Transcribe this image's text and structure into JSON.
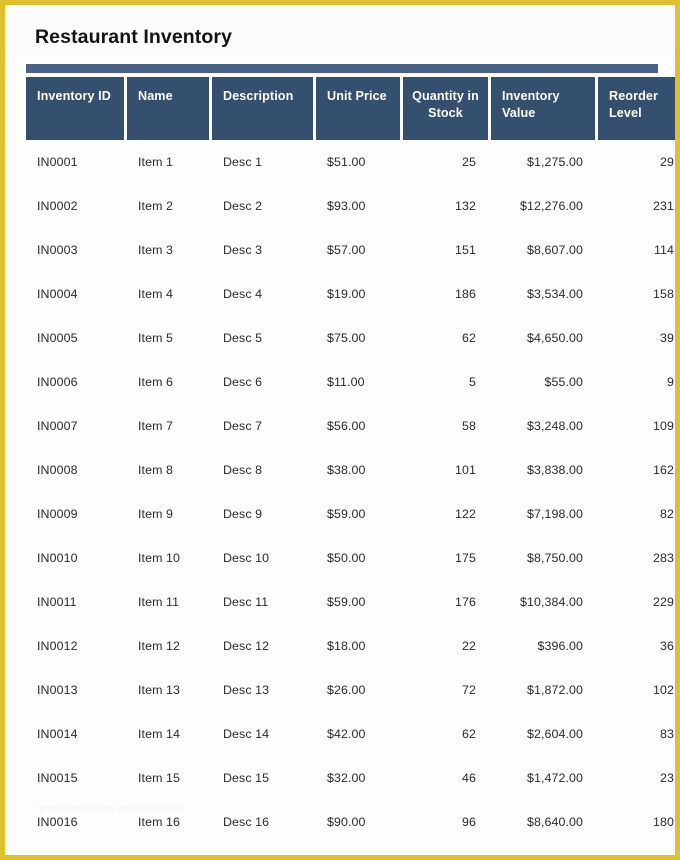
{
  "page": {
    "title": "Restaurant Inventory",
    "border_color": "#dfc12e",
    "accent_bar_color": "#4a6285",
    "header_color": "#35506f",
    "background_color": "#fdfdfb",
    "watermark": "www.templates-example.com"
  },
  "table": {
    "columns": [
      {
        "label": "Inventory ID",
        "align": "left"
      },
      {
        "label": "Name",
        "align": "left"
      },
      {
        "label": "Description",
        "align": "left"
      },
      {
        "label": "Unit Price",
        "align": "left"
      },
      {
        "label": "Quantity in Stock",
        "align": "center"
      },
      {
        "label": "Inventory Value",
        "align": "left"
      },
      {
        "label": "Reorder Level",
        "align": "left"
      }
    ],
    "rows": [
      {
        "id": "IN0001",
        "name": "Item 1",
        "desc": "Desc 1",
        "unit_price": "$51.00",
        "qty": "25",
        "value": "$1,275.00",
        "reorder": "29"
      },
      {
        "id": "IN0002",
        "name": "Item 2",
        "desc": "Desc 2",
        "unit_price": "$93.00",
        "qty": "132",
        "value": "$12,276.00",
        "reorder": "231"
      },
      {
        "id": "IN0003",
        "name": "Item 3",
        "desc": "Desc 3",
        "unit_price": "$57.00",
        "qty": "151",
        "value": "$8,607.00",
        "reorder": "114"
      },
      {
        "id": "IN0004",
        "name": "Item 4",
        "desc": "Desc 4",
        "unit_price": "$19.00",
        "qty": "186",
        "value": "$3,534.00",
        "reorder": "158"
      },
      {
        "id": "IN0005",
        "name": "Item 5",
        "desc": "Desc 5",
        "unit_price": "$75.00",
        "qty": "62",
        "value": "$4,650.00",
        "reorder": "39"
      },
      {
        "id": "IN0006",
        "name": "Item 6",
        "desc": "Desc 6",
        "unit_price": "$11.00",
        "qty": "5",
        "value": "$55.00",
        "reorder": "9"
      },
      {
        "id": "IN0007",
        "name": "Item 7",
        "desc": "Desc 7",
        "unit_price": "$56.00",
        "qty": "58",
        "value": "$3,248.00",
        "reorder": "109"
      },
      {
        "id": "IN0008",
        "name": "Item 8",
        "desc": "Desc 8",
        "unit_price": "$38.00",
        "qty": "101",
        "value": "$3,838.00",
        "reorder": "162"
      },
      {
        "id": "IN0009",
        "name": "Item 9",
        "desc": "Desc 9",
        "unit_price": "$59.00",
        "qty": "122",
        "value": "$7,198.00",
        "reorder": "82"
      },
      {
        "id": "IN0010",
        "name": "Item 10",
        "desc": "Desc 10",
        "unit_price": "$50.00",
        "qty": "175",
        "value": "$8,750.00",
        "reorder": "283"
      },
      {
        "id": "IN0011",
        "name": "Item 11",
        "desc": "Desc 11",
        "unit_price": "$59.00",
        "qty": "176",
        "value": "$10,384.00",
        "reorder": "229"
      },
      {
        "id": "IN0012",
        "name": "Item 12",
        "desc": "Desc 12",
        "unit_price": "$18.00",
        "qty": "22",
        "value": "$396.00",
        "reorder": "36"
      },
      {
        "id": "IN0013",
        "name": "Item 13",
        "desc": "Desc 13",
        "unit_price": "$26.00",
        "qty": "72",
        "value": "$1,872.00",
        "reorder": "102"
      },
      {
        "id": "IN0014",
        "name": "Item 14",
        "desc": "Desc 14",
        "unit_price": "$42.00",
        "qty": "62",
        "value": "$2,604.00",
        "reorder": "83"
      },
      {
        "id": "IN0015",
        "name": "Item 15",
        "desc": "Desc 15",
        "unit_price": "$32.00",
        "qty": "46",
        "value": "$1,472.00",
        "reorder": "23"
      },
      {
        "id": "IN0016",
        "name": "Item 16",
        "desc": "Desc 16",
        "unit_price": "$90.00",
        "qty": "96",
        "value": "$8,640.00",
        "reorder": "180"
      }
    ]
  }
}
